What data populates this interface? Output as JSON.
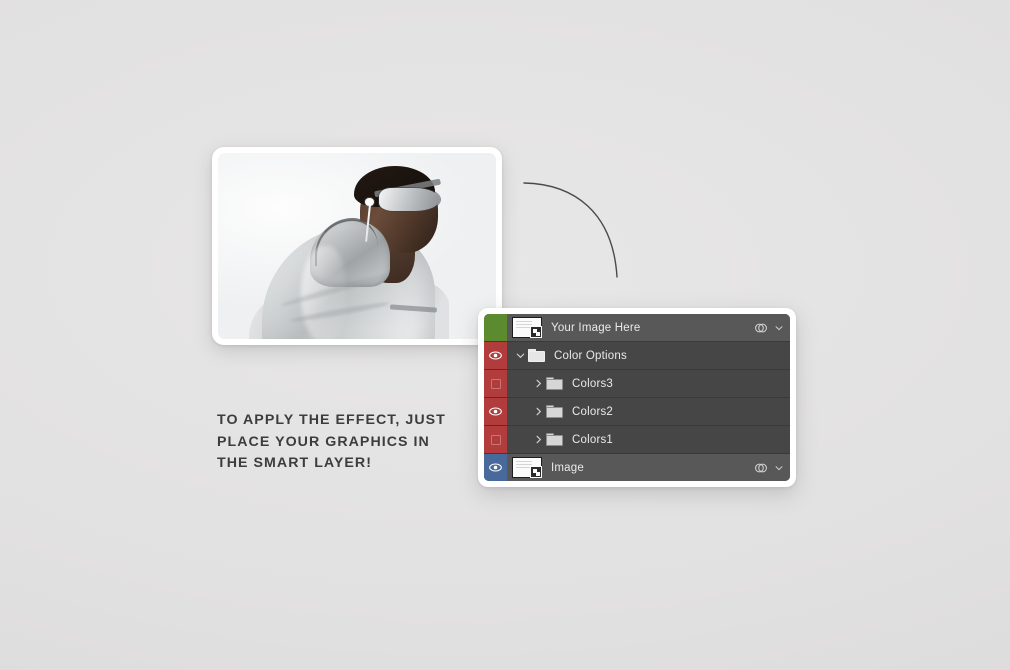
{
  "background_color": "#e3e2e2",
  "photo_card": {
    "name": "photo-card",
    "alt": "Man wearing silver metallic hooded jacket with mirrored sunglasses and white earphones"
  },
  "connector": {
    "name": "curved-connector-line",
    "color": "#4a4a4a"
  },
  "instructions": {
    "line1": "TO APPLY THE EFFECT, JUST",
    "line2": "PLACE YOUR GRAPHICS IN",
    "line3": "THE SMART LAYER!",
    "color": "#3c3c3c"
  },
  "layers_panel": {
    "panel_background": "#ffffff",
    "row_background": "#464646",
    "row_selected_background": "#585858",
    "text_color": "#e9e9e9",
    "tag_colors": {
      "green": "#5c8a2f",
      "red": "#b23c3c",
      "blue": "#47699c"
    },
    "rows": [
      {
        "name": "Your Image Here",
        "tag": "green",
        "visible": null,
        "selected": true,
        "indent": 0,
        "kind": "smart-object",
        "disclosure": "none",
        "has_fx": true,
        "has_chevron": true
      },
      {
        "name": "Color Options",
        "tag": "red",
        "visible": true,
        "selected": false,
        "indent": 0,
        "kind": "group-open",
        "disclosure": "expanded",
        "has_fx": false,
        "has_chevron": false
      },
      {
        "name": "Colors3",
        "tag": "red",
        "visible": false,
        "selected": false,
        "indent": 1,
        "kind": "group",
        "disclosure": "collapsed",
        "has_fx": false,
        "has_chevron": false
      },
      {
        "name": "Colors2",
        "tag": "red",
        "visible": true,
        "selected": false,
        "indent": 1,
        "kind": "group",
        "disclosure": "collapsed",
        "has_fx": false,
        "has_chevron": false
      },
      {
        "name": "Colors1",
        "tag": "red",
        "visible": false,
        "selected": false,
        "indent": 1,
        "kind": "group",
        "disclosure": "collapsed",
        "has_fx": false,
        "has_chevron": false
      },
      {
        "name": "Image",
        "tag": "blue",
        "visible": true,
        "selected": true,
        "indent": 0,
        "kind": "smart-object",
        "disclosure": "none",
        "has_fx": true,
        "has_chevron": true
      }
    ]
  }
}
